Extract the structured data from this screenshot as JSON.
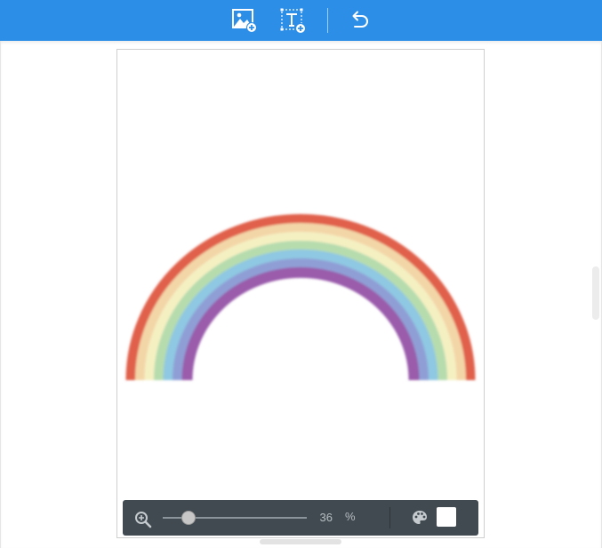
{
  "toolbar": {
    "buttons": [
      {
        "icon": "add-image-icon"
      },
      {
        "icon": "add-text-icon"
      },
      {
        "icon": "undo-icon"
      }
    ],
    "color": "#2d8ee8"
  },
  "canvas": {
    "background_color": "#ffffff",
    "rainbow_colors": [
      "#e0604c",
      "#f3d6a8",
      "#f4f0c2",
      "#b6dcae",
      "#8fc8e2",
      "#8f9fd6",
      "#9a5cab"
    ]
  },
  "zoom_bar": {
    "value": "36",
    "unit": "%",
    "level_fraction": 0.18,
    "background_color": "#404a50",
    "swatch_color": "#ffffff"
  }
}
